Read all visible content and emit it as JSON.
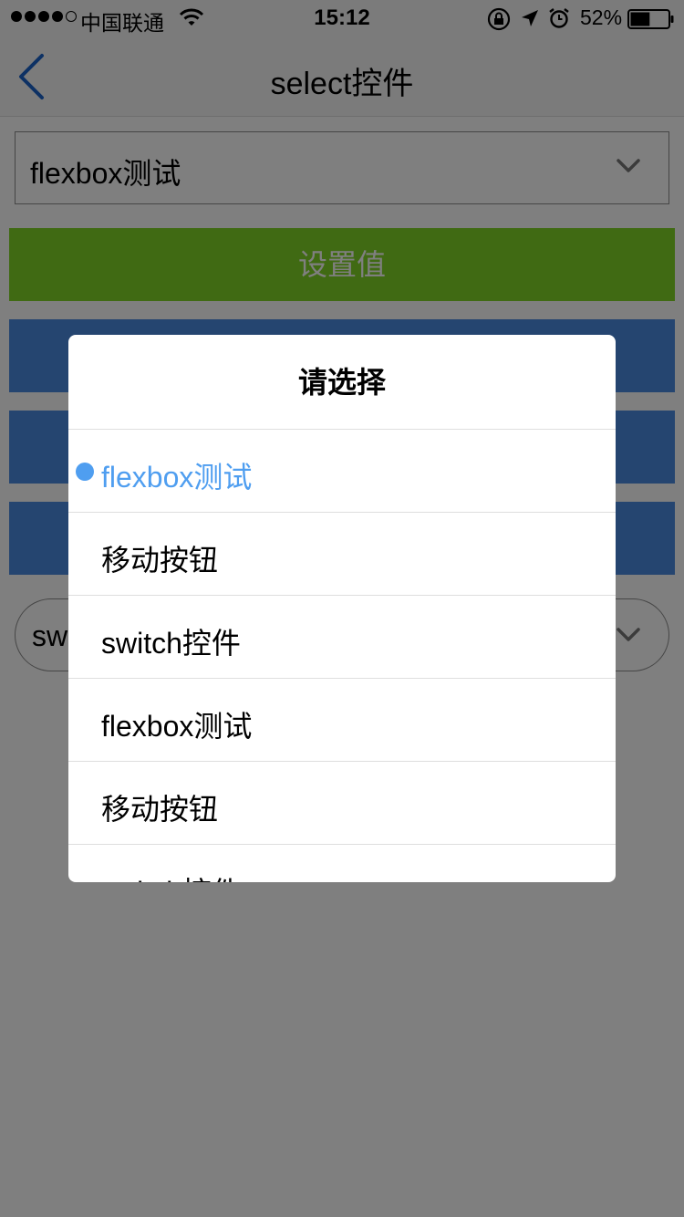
{
  "status_bar": {
    "carrier": "中国联通",
    "time": "15:12",
    "battery": "52%",
    "battery_level": 0.52
  },
  "nav": {
    "title": "select控件"
  },
  "select": {
    "value": "flexbox测试"
  },
  "buttons": {
    "set_value": "设置值",
    "blue_1": "",
    "blue_2": "",
    "blue_3": ""
  },
  "round_select": {
    "value": "sw"
  },
  "picker": {
    "title": "请选择",
    "options": [
      {
        "label": "flexbox测试",
        "selected": true
      },
      {
        "label": "移动按钮",
        "selected": false
      },
      {
        "label": "switch控件",
        "selected": false
      },
      {
        "label": "flexbox测试",
        "selected": false
      },
      {
        "label": "移动按钮",
        "selected": false
      },
      {
        "label": "switch控件",
        "selected": false
      }
    ]
  },
  "colors": {
    "accent": "#4f9ef0",
    "green_button": "#81d427",
    "blue_button": "#4a8ae0",
    "back_arrow": "#1a62c9"
  }
}
